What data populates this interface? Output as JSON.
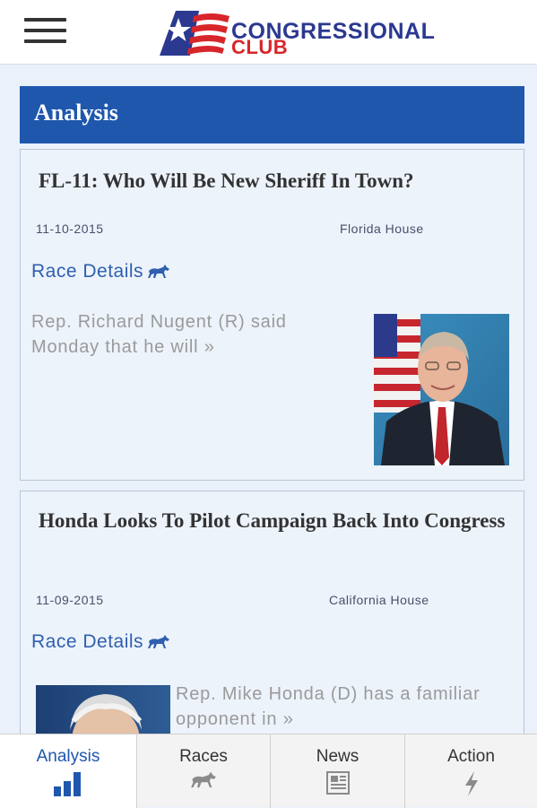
{
  "header": {
    "menu_icon": "hamburger-menu-icon",
    "logo": {
      "line1": "CONGRESSIONAL",
      "line2": "CLUB",
      "icon": "star-flag-logo-icon"
    }
  },
  "section": {
    "title": "Analysis"
  },
  "articles": [
    {
      "title": "FL-11: Who Will Be New Sheriff In Town?",
      "date": "11-10-2015",
      "category": "Florida House",
      "race_link": "Race Details",
      "race_icon": "horse-icon",
      "excerpt": "Rep. Richard Nugent (R) said Monday that he will »"
    },
    {
      "title": "Honda Looks To Pilot Campaign Back Into Congress",
      "date": "11-09-2015",
      "category": "California House",
      "race_link": "Race Details",
      "race_icon": "horse-icon",
      "excerpt": "Rep. Mike Honda (D) has a familiar opponent in »"
    }
  ],
  "bottom_nav": [
    {
      "label": "Analysis",
      "icon": "bar-chart-icon",
      "active": true
    },
    {
      "label": "Races",
      "icon": "horse-icon",
      "active": false
    },
    {
      "label": "News",
      "icon": "newspaper-icon",
      "active": false
    },
    {
      "label": "Action",
      "icon": "lightning-icon",
      "active": false
    }
  ],
  "colors": {
    "brand_blue": "#1f57ad",
    "brand_red": "#d7262b",
    "link_blue": "#2f5fae",
    "background": "#eaf1fa"
  }
}
